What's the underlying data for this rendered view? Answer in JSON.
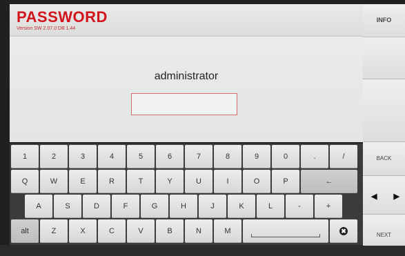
{
  "header": {
    "title": "PASSWORD",
    "version": "Version SW 2.07.0 DB 1.44"
  },
  "main": {
    "username": "administrator",
    "password_value": ""
  },
  "sidebar": {
    "info": "INFO",
    "back": "BACK",
    "left_arrow": "◀",
    "right_arrow": "▶",
    "next": "NEXT"
  },
  "keyboard": {
    "row1": [
      "1",
      "2",
      "3",
      "4",
      "5",
      "6",
      "7",
      "8",
      "9",
      "0",
      ".",
      "/"
    ],
    "row2": [
      "Q",
      "W",
      "E",
      "R",
      "T",
      "Y",
      "U",
      "I",
      "O",
      "P",
      "←"
    ],
    "row3": [
      "A",
      "S",
      "D",
      "F",
      "G",
      "H",
      "J",
      "K",
      "L",
      "-",
      "+"
    ],
    "row4_alt": "alt",
    "row4": [
      "Z",
      "X",
      "C",
      "V",
      "B",
      "N",
      "M"
    ],
    "delete_icon": "✖"
  }
}
